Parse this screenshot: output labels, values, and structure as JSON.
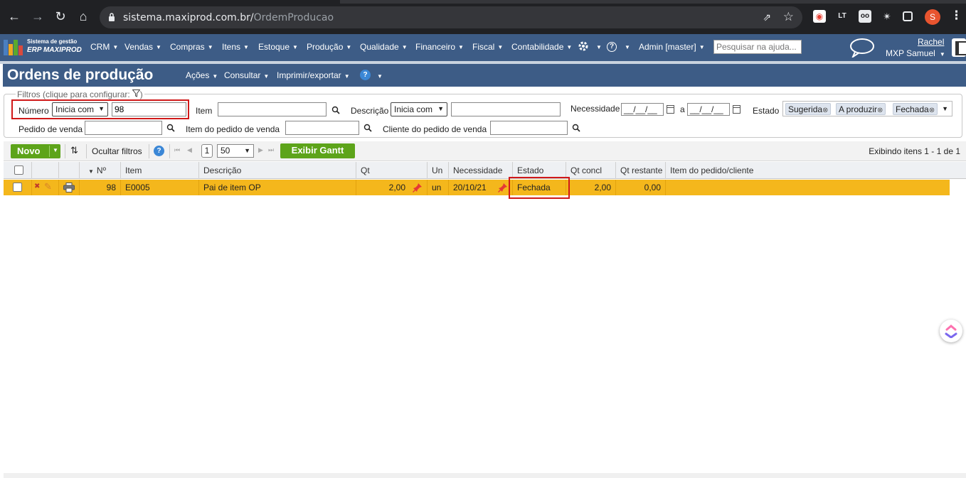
{
  "browser": {
    "url_host": "sistema.maxiprod.com.br/",
    "url_path": "OrdemProducao",
    "profile_initial": "S"
  },
  "appbar": {
    "brand_line1": "Sistema de gestão",
    "brand_line2": "ERP MAXIPROD",
    "menus": [
      "CRM",
      "Vendas",
      "Compras",
      "Itens",
      "Estoque",
      "Produção",
      "Qualidade",
      "Financeiro",
      "Fiscal",
      "Contabilidade"
    ],
    "admin_label": "Admin [master]",
    "search_placeholder": "Pesquisar na ajuda...",
    "user_name": "Rachel",
    "user_company": "MXP Samuel",
    "accent_color": "#3d5c86"
  },
  "page": {
    "title": "Ordens de produção",
    "menus": [
      "Ações",
      "Consultar",
      "Imprimir/exportar"
    ],
    "help_symbol": "?"
  },
  "filters": {
    "legend": "Filtros (clique para configurar:",
    "numero_label": "Número",
    "numero_operator": "Inicia com",
    "numero_value": "98",
    "item_label": "Item",
    "item_value": "",
    "descricao_label": "Descrição",
    "descricao_operator": "Inicia com",
    "descricao_value": "",
    "necessidade_label": "Necessidade",
    "date_from": "__/__/__",
    "date_sep": "a",
    "date_to": "__/__/__",
    "estado_label": "Estado",
    "estado_chips": [
      "Sugerida",
      "A produzir",
      "Fechada"
    ],
    "pedido_label": "Pedido de venda",
    "item_pedido_label": "Item do pedido de venda",
    "cliente_label": "Cliente do pedido de venda"
  },
  "toolbar": {
    "novo_label": "Novo",
    "ocultar_label": "Ocultar filtros",
    "page_number": "1",
    "page_size": "50",
    "gantt_label": "Exibir Gantt",
    "showing_text": "Exibindo itens 1 - 1 de 1",
    "button_color": "#5da41a"
  },
  "grid": {
    "columns": [
      "Nº",
      "Item",
      "Descrição",
      "Qt",
      "Un",
      "Necessidade",
      "Estado",
      "Qt concl",
      "Qt restante",
      "Item do pedido/cliente"
    ],
    "rows": [
      {
        "numero": "98",
        "item": "E0005",
        "descricao": "Pai de item OP",
        "qt": "2,00",
        "un": "un",
        "necessidade": "20/10/21",
        "estado": "Fechada",
        "qt_concl": "2,00",
        "qt_restante": "0,00",
        "item_pedido": ""
      }
    ],
    "selected_row_color": "#f4b71c",
    "highlight_color": "#d01919"
  }
}
